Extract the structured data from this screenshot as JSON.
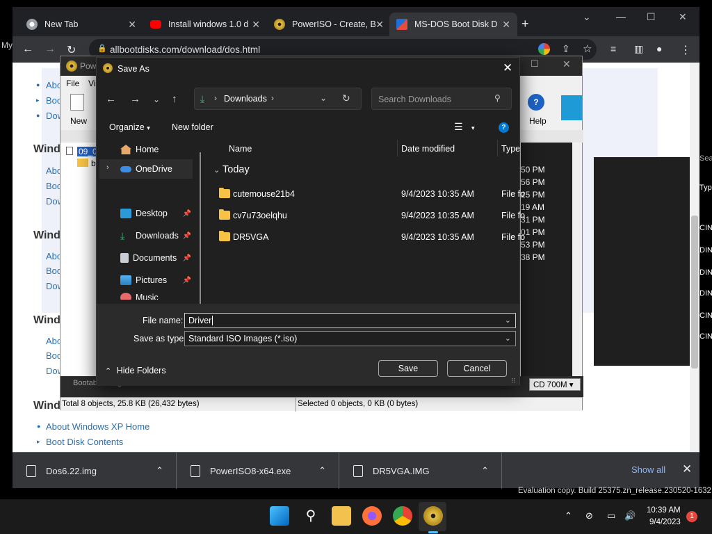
{
  "browser": {
    "tabs": [
      {
        "title": "New Tab",
        "icon": "chrome-icon"
      },
      {
        "title": "Install windows 1.0 d",
        "icon": "youtube-icon"
      },
      {
        "title": "PowerISO - Create, B",
        "icon": "poweriso-icon"
      },
      {
        "title": "MS-DOS Boot Disk D",
        "icon": "msdos-icon",
        "active": true
      }
    ],
    "url": "allbootdisks.com/download/dos.html",
    "profile_fragment": "My"
  },
  "webpage": {
    "nav_sections": [
      {
        "links": [
          "Abo",
          "Boo",
          "Dow"
        ]
      },
      {
        "heading": "Windo",
        "links": [
          "Abo",
          "Boo",
          "Dow"
        ]
      },
      {
        "heading": "Wind",
        "links": [
          "Abo",
          "Boo",
          "Dow"
        ]
      },
      {
        "heading": "Wind",
        "links": [
          "Abo",
          "Boo",
          "Dow"
        ]
      },
      {
        "heading": "Wind",
        "links": [
          "About Windows XP Home",
          "Boot Disk Contents",
          "Download Boot Disks"
        ]
      }
    ],
    "right_col_labels": [
      "Sea",
      "Typ",
      "CIN",
      "DIN",
      "DIN",
      "DIN",
      "CIN",
      "CIN"
    ]
  },
  "poweriso": {
    "title_fragment": "Pow",
    "menu": [
      "File",
      "Vi"
    ],
    "toolbar": {
      "new_label": "New",
      "help_label": "Help"
    },
    "tree_item": "09_0",
    "tree_sub": "b",
    "times": [
      "50 PM",
      "56 PM",
      "25 PM",
      "19 AM",
      "31 PM",
      "01 PM",
      "53 PM",
      "38 PM"
    ],
    "status_left": "Total 8 objects, 25.8 KB (26,432 bytes)",
    "status_right": "Selected 0 objects, 0 KB (0 bytes)",
    "bootable_label": "Bootable image",
    "media_select": "CD 700M"
  },
  "dialog": {
    "title": "Save As",
    "address": {
      "location": "Downloads"
    },
    "search_placeholder": "Search Downloads",
    "commands": {
      "organize": "Organize",
      "new_folder": "New folder"
    },
    "nav_tree": [
      {
        "label": "Home",
        "icon": "home-icon"
      },
      {
        "label": "OneDrive",
        "icon": "onedrive-icon",
        "selected": true
      },
      {
        "label": "Desktop",
        "icon": "desktop-icon",
        "pinned": true
      },
      {
        "label": "Downloads",
        "icon": "download-icon",
        "pinned": true
      },
      {
        "label": "Documents",
        "icon": "documents-icon",
        "pinned": true
      },
      {
        "label": "Pictures",
        "icon": "pictures-icon",
        "pinned": true
      },
      {
        "label": "Music",
        "icon": "music-icon"
      }
    ],
    "columns": {
      "name": "Name",
      "date_modified": "Date modified",
      "type": "Type"
    },
    "group": "Today",
    "files": [
      {
        "name": "cutemouse21b4",
        "date": "9/4/2023 10:35 AM",
        "type": "File fo"
      },
      {
        "name": "cv7u73oelqhu",
        "date": "9/4/2023 10:35 AM",
        "type": "File fo"
      },
      {
        "name": "DR5VGA",
        "date": "9/4/2023 10:35 AM",
        "type": "File fo"
      }
    ],
    "file_name_label": "File name:",
    "file_name_value": "Driver",
    "save_as_type_label": "Save as type:",
    "save_as_type_value": "Standard ISO Images (*.iso)",
    "hide_folders": "Hide Folders",
    "save_button": "Save",
    "cancel_button": "Cancel"
  },
  "downloads_bar": {
    "items": [
      "Dos6.22.img",
      "PowerISO8-x64.exe",
      "DR5VGA.IMG"
    ],
    "show_all": "Show all"
  },
  "watermark": "Evaluation copy. Build 25375.zn_release.230520-1632",
  "taskbar": {
    "time": "10:39 AM",
    "date": "9/4/2023",
    "notification_count": "1"
  },
  "colors": {
    "dialog_bg": "#202020",
    "accent": "#0078d4",
    "link": "#2a6fb0",
    "folder": "#f6c344"
  }
}
